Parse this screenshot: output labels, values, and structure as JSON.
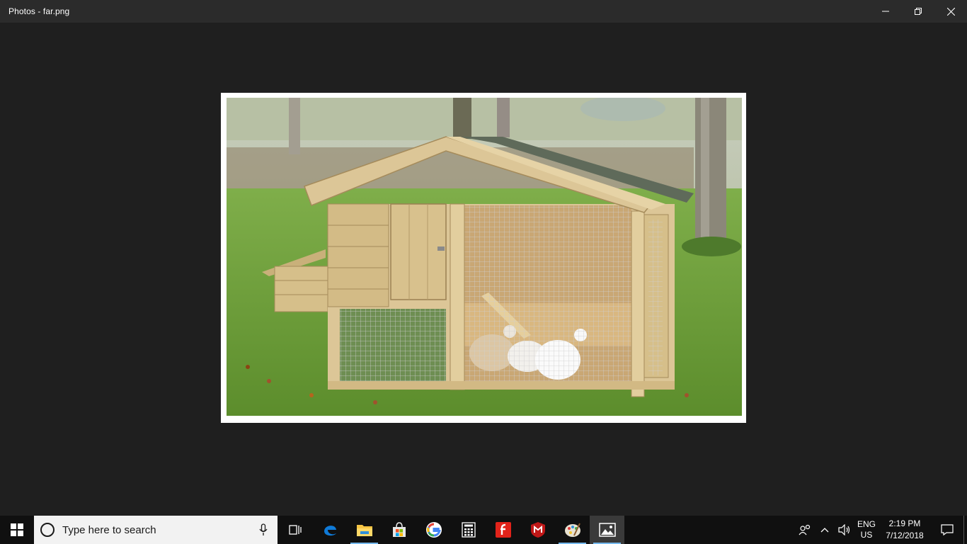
{
  "window": {
    "title": "Photos - far.png",
    "controls": [
      "minimize",
      "restore",
      "close"
    ]
  },
  "photo": {
    "alt": "Wooden chicken coop with three chickens on grass"
  },
  "taskbar": {
    "search_placeholder": "Type here to search",
    "pinned_apps": [
      {
        "name": "task-view-icon",
        "running": false
      },
      {
        "name": "edge-icon",
        "running": false
      },
      {
        "name": "file-explorer-icon",
        "running": true
      },
      {
        "name": "store-icon",
        "running": false
      },
      {
        "name": "google-chrome-icon",
        "running": false
      },
      {
        "name": "calculator-icon",
        "running": false
      },
      {
        "name": "foxit-reader-icon",
        "running": false
      },
      {
        "name": "mcafee-icon",
        "running": false
      },
      {
        "name": "paint-icon",
        "running": true
      },
      {
        "name": "photos-icon",
        "running": true,
        "active": true
      }
    ],
    "language_line1": "ENG",
    "language_line2": "US",
    "time": "2:19 PM",
    "date": "7/12/2018"
  },
  "colors": {
    "titlebar": "#2b2b2b",
    "background": "#1f1f1f",
    "taskbar": "#101010",
    "accent": "#76b9ed"
  }
}
